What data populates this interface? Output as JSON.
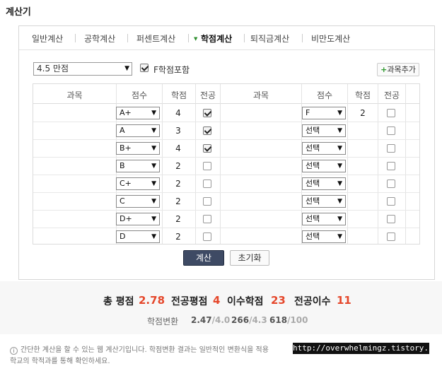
{
  "title": "계산기",
  "tabs": [
    "일반계산",
    "공학계산",
    "퍼센트계산",
    "학점계산",
    "퇴직금계산",
    "비만도계산"
  ],
  "active_tab": "학점계산",
  "scale_select": "4.5 만점",
  "f_include_label": "F학점포함",
  "f_include_checked": true,
  "add_subject_label": "과목추가",
  "table_headers": [
    "과목",
    "점수",
    "학점",
    "전공"
  ],
  "left_rows": [
    {
      "grade": "A+",
      "credit": "4",
      "major": true
    },
    {
      "grade": "A",
      "credit": "3",
      "major": true
    },
    {
      "grade": "B+",
      "credit": "4",
      "major": true
    },
    {
      "grade": "B",
      "credit": "2",
      "major": false
    },
    {
      "grade": "C+",
      "credit": "2",
      "major": false
    },
    {
      "grade": "C",
      "credit": "2",
      "major": false
    },
    {
      "grade": "D+",
      "credit": "2",
      "major": false
    },
    {
      "grade": "D",
      "credit": "2",
      "major": false
    }
  ],
  "right_rows": [
    {
      "grade": "F",
      "credit": "2",
      "major": false
    },
    {
      "grade": "선택",
      "credit": "",
      "major": false
    },
    {
      "grade": "선택",
      "credit": "",
      "major": false
    },
    {
      "grade": "선택",
      "credit": "",
      "major": false
    },
    {
      "grade": "선택",
      "credit": "",
      "major": false
    },
    {
      "grade": "선택",
      "credit": "",
      "major": false
    },
    {
      "grade": "선택",
      "credit": "",
      "major": false
    },
    {
      "grade": "선택",
      "credit": "",
      "major": false
    }
  ],
  "buttons": {
    "calculate": "계산",
    "reset": "초기화"
  },
  "summary": {
    "total_label": "총 평점",
    "total_value": "2.78",
    "major_label": "전공평점",
    "major_value": "4",
    "credits_label": "이수학점",
    "credits_value": "23",
    "major_credits_label": "전공이수",
    "major_credits_value": "11"
  },
  "conversion": {
    "label": "학점변환",
    "items": [
      {
        "value": "2.47",
        "max": "/4.0"
      },
      {
        "value": "266",
        "max": "/4.3"
      },
      {
        "value": "618",
        "max": "/100"
      }
    ]
  },
  "notice_line1": "간단한 계산을 할 수 있는 웹 계산기입니다. 학점변환 결과는 일반적인 변환식을 적용",
  "notice_line2": "학교의 학적과를 통해 확인하세요.",
  "watermark": "http://overwhelmingz.tistory.com"
}
